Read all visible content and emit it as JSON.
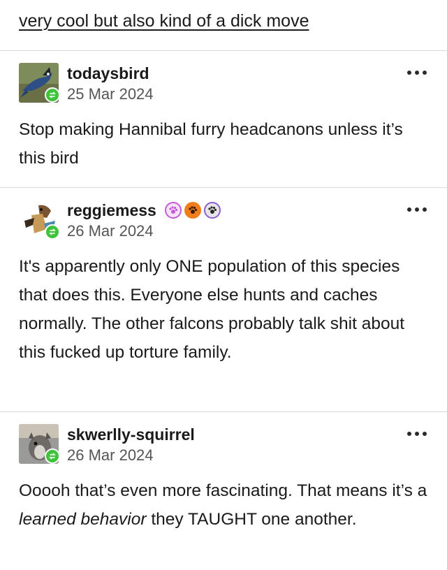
{
  "header": {
    "title": "very cool but also kind of a dick move"
  },
  "posts": [
    {
      "username": "todaysbird",
      "date": "25 Mar 2024",
      "body": [
        {
          "text": "Stop making Hannibal furry headcanons unless it’s this bird",
          "italic": false
        }
      ],
      "avatar_icon": "bird-photo-icon",
      "badges": []
    },
    {
      "username": "reggiemess",
      "date": "26 Mar 2024",
      "body": [
        {
          "text": "It's apparently only ONE population of this species that does this. Everyone else hunts and caches normally. The other falcons probably talk shit about this fucked up torture family.",
          "italic": false
        }
      ],
      "avatar_icon": "character-art-icon",
      "badges": [
        {
          "icon": "paw-icon",
          "color": "#c45bd8"
        },
        {
          "icon": "paw-orange-icon",
          "color": "#f07d1c"
        },
        {
          "icon": "paw-gray-icon",
          "color": "#8e5fd0"
        }
      ]
    },
    {
      "username": "skwerlly-squirrel",
      "date": "26 Mar 2024",
      "body": [
        {
          "text": "Ooooh that’s even more fascinating. That means it’s a ",
          "italic": false
        },
        {
          "text": "learned behavior",
          "italic": true
        },
        {
          "text": " they TAUGHT one another.",
          "italic": false
        }
      ],
      "avatar_icon": "squirrel-photo-icon",
      "badges": []
    }
  ],
  "colors": {
    "reblog_green": "#3ec33a",
    "divider": "#d8d8d8",
    "date_gray": "#555555"
  }
}
